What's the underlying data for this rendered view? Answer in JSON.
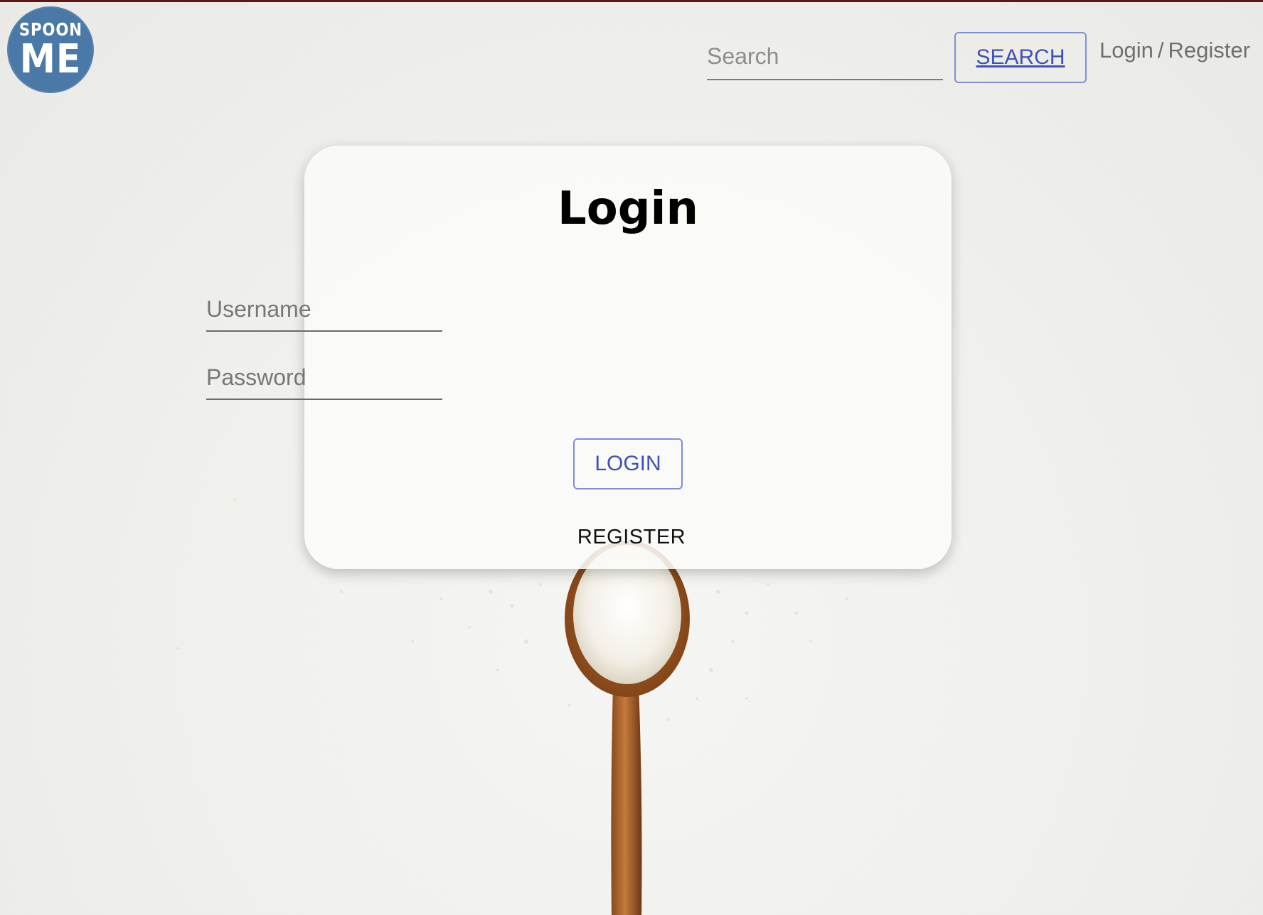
{
  "header": {
    "logo": {
      "line1": "SPOON",
      "line2": "ME",
      "color": "#4a79a8"
    },
    "search": {
      "placeholder": "Search",
      "button_label": "SEARCH"
    },
    "auth": {
      "login_label": "Login",
      "separator": "/",
      "register_label": "Register"
    }
  },
  "login_card": {
    "title": "Login",
    "username_placeholder": "Username",
    "password_placeholder": "Password",
    "login_button": "LOGIN",
    "register_link": "REGISTER"
  },
  "colors": {
    "accent": "#3f51b5",
    "button_border": "#7e8fd3",
    "top_bar": "#5b1616"
  },
  "background": {
    "image_icon": "wooden-spoon-coconut-icon"
  }
}
